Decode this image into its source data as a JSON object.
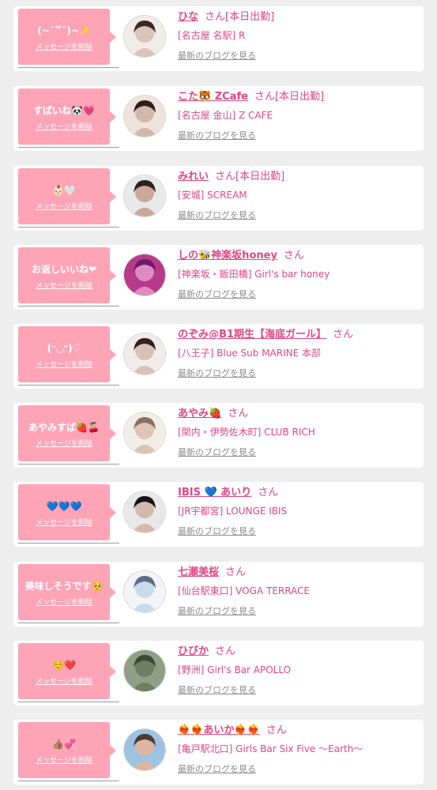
{
  "colors": {
    "background": "#eeeeee",
    "card": "#ffffff",
    "bubble": "#ffa4b7",
    "name": "#e24782",
    "blog_link": "#8d8d8d"
  },
  "labels": {
    "san": "さん",
    "delete_message": "メッセージを削除",
    "view_blog": "最新のブログを見る",
    "on_duty": "[本日出勤]"
  },
  "messages": [
    {
      "message": "(~˘꒳˘)~✨",
      "name": "ひな",
      "on_duty": true,
      "shop": "[名古屋 名駅] R",
      "avatar_icon": "avatar-photo-icon"
    },
    {
      "message": "すばいね🐼💗",
      "name": "こた🐯 ZCafe",
      "on_duty": true,
      "shop": "[名古屋 金山] Z CAFE",
      "avatar_icon": "avatar-photo-icon"
    },
    {
      "message": "👶🏻🤍",
      "name": "みれい",
      "on_duty": true,
      "shop": "[安城] SCREAM",
      "avatar_icon": "avatar-photo-icon"
    },
    {
      "message": "お返しいいね❤︎",
      "name": "しの🐝神楽坂honey",
      "on_duty": false,
      "shop": "[神楽坂・飯田橋] Girl's bar honey",
      "avatar_icon": "avatar-photo-icon"
    },
    {
      "message": "(ᵔ◡ᵔ)♡",
      "name": "のぞみ@B1期生【海底ガール】",
      "on_duty": false,
      "shop": "[八王子] Blue Sub MARINE 本部",
      "avatar_icon": "avatar-photo-icon"
    },
    {
      "message": "あやみすば🍓🍒",
      "name": "あやみ🍓",
      "on_duty": false,
      "shop": "[関内・伊勢佐木町] CLUB RICH",
      "avatar_icon": "avatar-photo-icon"
    },
    {
      "message": "💙💙💙",
      "name": "IBIS 💙 あいり",
      "on_duty": false,
      "shop": "[JR宇都宮] LOUNGE IBIS",
      "avatar_icon": "avatar-photo-icon"
    },
    {
      "message": "美味しそうです🥺",
      "name": "七瀬美桜",
      "on_duty": false,
      "shop": "[仙台駅東口] VOGA TERRACE",
      "avatar_icon": "avatar-photo-icon"
    },
    {
      "message": "☺️❤️",
      "name": "ひびか",
      "on_duty": false,
      "shop": "[野洲] Girl's Bar APOLLO",
      "avatar_icon": "avatar-photo-icon"
    },
    {
      "message": "👍🏽💞",
      "name": "❤️‍🔥❤️‍🔥あいか❤️‍🔥❤️‍🔥",
      "on_duty": false,
      "shop": "[亀戸駅北口] Girls Bar Six Five 〜Earth〜",
      "avatar_icon": "avatar-photo-icon"
    }
  ]
}
